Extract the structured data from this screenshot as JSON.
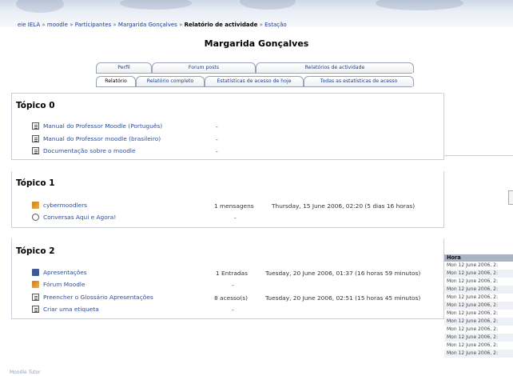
{
  "breadcrumb": {
    "items": [
      "eie IELA",
      "moodle",
      "Participantes",
      "Margarida Gonçalves",
      "Relatório de actividade",
      "Estação"
    ]
  },
  "page_title": "Margarida Gonçalves",
  "tabs_row1": [
    "Perfil",
    "Forum posts",
    "Relatórios de actividade"
  ],
  "tabs_row2": [
    "Relatório",
    "Relatório completo",
    "Estatísticas de acesso de hoje",
    "Todas as estatísticas de acesso"
  ],
  "sections": [
    {
      "title": "Tópico 0",
      "rows": [
        {
          "icon": "document-icon",
          "label": "Manual do Professor Moodle (Português)",
          "count": "-",
          "date": ""
        },
        {
          "icon": "document-icon",
          "label": "Manual do Professor moodle (brasileiro)",
          "count": "-",
          "date": ""
        },
        {
          "icon": "document-icon",
          "label": "Documentação sobre o moodle",
          "count": "-",
          "date": ""
        }
      ]
    },
    {
      "title": "Tópico 1",
      "rows": [
        {
          "icon": "forum-icon",
          "label": "cybermoodlers",
          "count": "1 mensagens",
          "date": "Thursday, 15 June 2006, 02:20 (5 dias 16 horas)"
        },
        {
          "icon": "chat-icon",
          "label": "Conversas Aqui e Agora!",
          "count": "-",
          "date": ""
        }
      ]
    },
    {
      "title": "Tópico 2",
      "rows": [
        {
          "icon": "glossary-icon",
          "label": "Apresentações",
          "count": "1 Entradas",
          "date": "Tuesday, 20 June 2006, 01:37 (16 horas 59 minutos)"
        },
        {
          "icon": "forum-icon",
          "label": "Fórum Moodle",
          "count": "-",
          "date": ""
        },
        {
          "icon": "document-icon",
          "label": "Preencher o Glossário Apresentações",
          "count": "8 acesso(s)",
          "date": "Tuesday, 20 June 2006, 02:51 (15 horas 45 minutos)"
        },
        {
          "icon": "document-icon",
          "label": "Criar uma etiqueta",
          "count": "-",
          "date": ""
        }
      ]
    }
  ],
  "log": {
    "header": "Hora",
    "rows": [
      "Mon 12 June 2006, 2:",
      "Mon 12 June 2006, 2:",
      "Mon 12 June 2006, 2:",
      "Mon 12 June 2006, 2:",
      "Mon 12 June 2006, 2:",
      "Mon 12 June 2006, 2:",
      "Mon 12 June 2006, 2:",
      "Mon 12 June 2006, 2:",
      "Mon 12 June 2006, 2:",
      "Mon 12 June 2006, 2:",
      "Mon 12 June 2006, 2:",
      "Mon 12 June 2006, 2:"
    ]
  },
  "footer": "Moodle Tutor"
}
